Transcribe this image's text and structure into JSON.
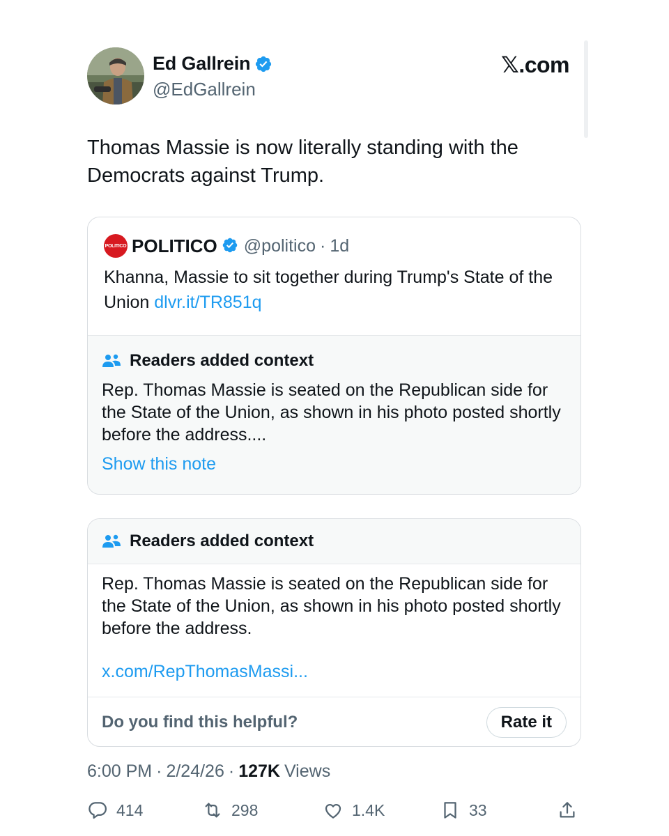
{
  "header": {
    "display_name": "Ed Gallrein",
    "handle": "@EdGallrein",
    "brand": "𝕏.com"
  },
  "tweet": {
    "text": "Thomas Massie is now literally standing with the Democrats against Trump."
  },
  "quote": {
    "logo_text": "POLITICO",
    "name": "POLITICO",
    "handle": "@politico",
    "dot": "·",
    "time": "1d",
    "text": "Khanna, Massie to sit together during Trump's State of the Union ",
    "link": "dlvr.it/TR851q",
    "note": {
      "title": "Readers added context",
      "body": "Rep. Thomas Massie is seated on the Republican side for the State of the Union, as shown in his photo posted shortly before the address....",
      "show_label": "Show this note"
    }
  },
  "context_note": {
    "title": "Readers added context",
    "body": "Rep. Thomas Massie is seated on the Republican side for the State of the Union, as shown in his photo posted shortly before the address.",
    "link": "x.com/RepThomasMassi...",
    "helpful_prompt": "Do you find this helpful?",
    "rate_label": "Rate it"
  },
  "meta": {
    "time": "6:00 PM",
    "sep1": "·",
    "date": "2/24/26",
    "sep2": "·",
    "views_count": "127K",
    "views_label": "Views"
  },
  "actions": {
    "replies": "414",
    "reposts": "298",
    "likes": "1.4K",
    "bookmarks": "33"
  },
  "colors": {
    "accent": "#1d9bf0",
    "text": "#0f1419",
    "muted": "#536471",
    "politico_red": "#d71920"
  }
}
